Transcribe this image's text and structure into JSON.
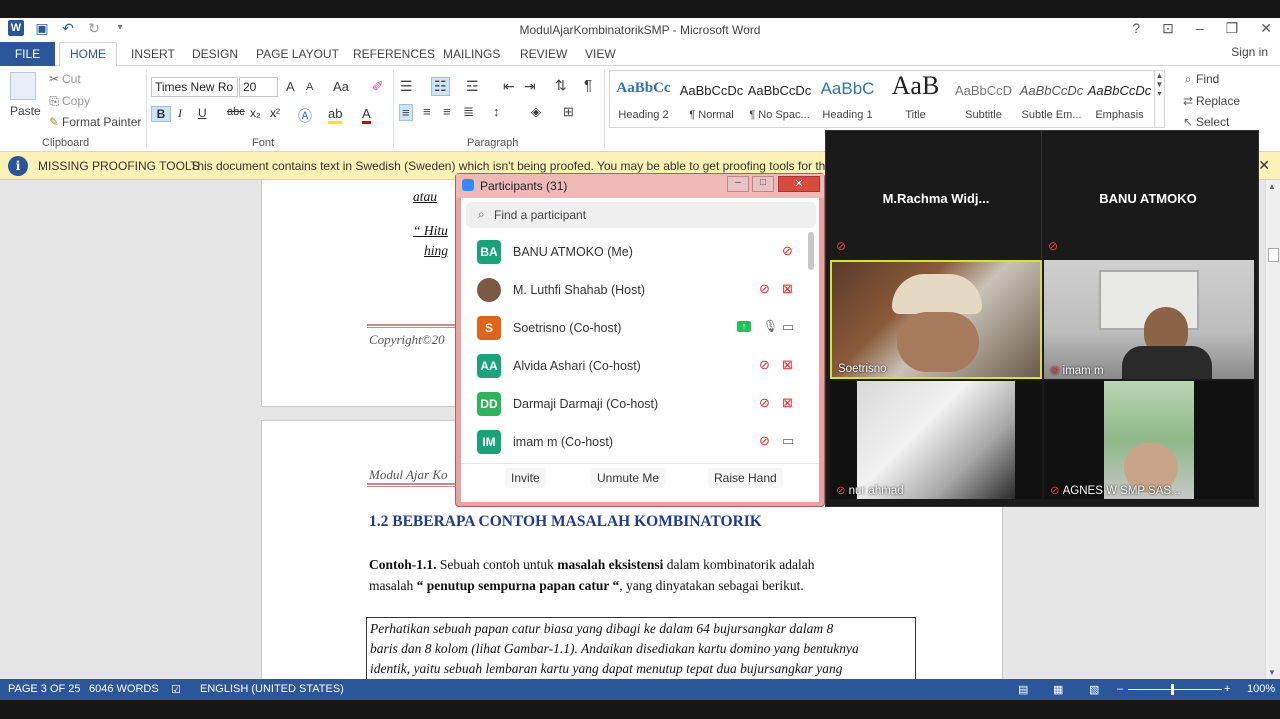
{
  "window": {
    "title": "ModulAjarKombinatorikSMP - Microsoft Word",
    "help": "?",
    "minimize": "–",
    "restore": "❐",
    "close": "✕"
  },
  "ribbon_tabs": [
    "FILE",
    "HOME",
    "INSERT",
    "DESIGN",
    "PAGE LAYOUT",
    "REFERENCES",
    "MAILINGS",
    "REVIEW",
    "VIEW"
  ],
  "signin": "Sign in",
  "clipboard": {
    "paste": "Paste",
    "cut": "Cut",
    "copy": "Copy",
    "format_painter": "Format Painter",
    "label": "Clipboard"
  },
  "font": {
    "name": "Times New Ro",
    "size": "20",
    "label": "Font",
    "grow": "A",
    "shrink": "A",
    "case": "Aa",
    "bold": "B",
    "italic": "I",
    "underline": "U",
    "strike": "abc",
    "sub": "x₂",
    "sup": "x²"
  },
  "paragraph": {
    "label": "Paragraph"
  },
  "styles": [
    {
      "preview": "AaBbCc",
      "name": "Heading 2"
    },
    {
      "preview": "AaBbCcDc",
      "name": "¶ Normal"
    },
    {
      "preview": "AaBbCcDc",
      "name": "¶ No Spac..."
    },
    {
      "preview": "AaBbC",
      "name": "Heading 1"
    },
    {
      "preview": "AaB",
      "name": "Title"
    },
    {
      "preview": "AaBbCcD",
      "name": "Subtitle"
    },
    {
      "preview": "AaBbCcDc",
      "name": "Subtle Em..."
    },
    {
      "preview": "AaBbCcDc",
      "name": "Emphasis"
    }
  ],
  "editing": {
    "find": "Find",
    "replace": "Replace",
    "select": "Select"
  },
  "message_bar": {
    "title": "MISSING PROOFING TOOLS",
    "text": "This document contains text in Swedish (Sweden) which isn't being proofed. You may be able to get proofing tools for this langu"
  },
  "document": {
    "p1_atau": "atau",
    "p1_hitu": "“ Hitu",
    "p1_hing": "hing",
    "p1_copyright": "Copyright©20",
    "p2_header": "Modul Ajar Ko",
    "heading": "1.2  BEBERAPA CONTOH MASALAH KOMBINATORIK",
    "contoh_label": "Contoh-1.1.",
    "contoh_text_a": " Sebuah contoh untuk ",
    "contoh_bold1": "masalah eksistensi",
    "contoh_text_b": " dalam kombinatorik adalah",
    "contoh_line2_a": "masalah ",
    "contoh_bold2": "“ penutup sempurna papan catur “",
    "contoh_line2_b": ",  yang dinyatakan sebagai berikut.",
    "box_line1": "Perhatikan sebuah papan catur biasa yang dibagi ke dalam  64  bujursangkar dalam  8",
    "box_line2": "baris dan 8 kolom (lihat Gambar-1.1).  Andaikan disediakan kartu domino yang bentuknya",
    "box_line3": "identik, yaitu sebuah lembaran kartu yang dapat menutup tepat dua bujursangkar yang"
  },
  "status": {
    "page": "PAGE 3 OF 25",
    "words": "6046 WORDS",
    "language": "ENGLISH (UNITED STATES)",
    "zoom": "100%",
    "zoom_minus": "–",
    "zoom_plus": "+"
  },
  "participants": {
    "title": "Participants (31)",
    "search_placeholder": "Find a participant",
    "list": [
      {
        "initials": "BA",
        "name": "BANU ATMOKO (Me)",
        "color": "#1aa37a"
      },
      {
        "initials": "",
        "name": "M. Luthfi Shahab (Host)",
        "color": "#6b4a3a"
      },
      {
        "initials": "S",
        "name": "Soetrisno (Co-host)",
        "color": "#e0651b"
      },
      {
        "initials": "AA",
        "name": "Alvida Ashari (Co-host)",
        "color": "#1aa37a"
      },
      {
        "initials": "DD",
        "name": "Darmaji Darmaji (Co-host)",
        "color": "#2fb35a"
      },
      {
        "initials": "IM",
        "name": "imam m (Co-host)",
        "color": "#1aa37a"
      }
    ],
    "invite": "Invite",
    "unmute": "Unmute Me",
    "raise_hand": "Raise Hand"
  },
  "gallery": {
    "top_left_name": "M.Rachma  Widj...",
    "top_right_name": "BANU ATMOKO",
    "tiles": [
      "Soetrisno",
      "imam m",
      "nur ahmad",
      "AGNES W  SMP SAS..."
    ]
  }
}
